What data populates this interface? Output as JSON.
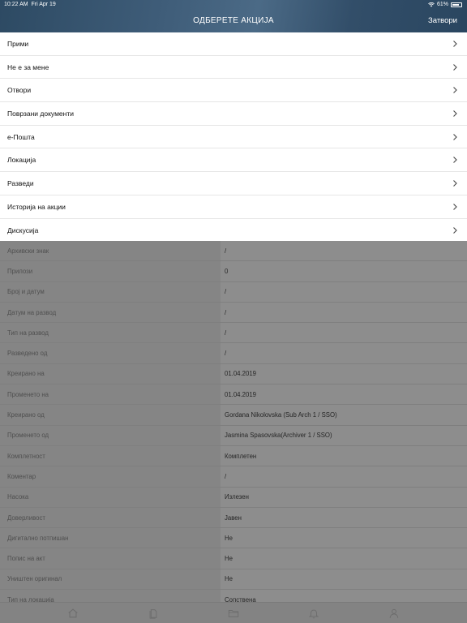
{
  "status_bar": {
    "time": "10:22 AM",
    "date": "Fri Apr 19",
    "battery": "61%"
  },
  "header": {
    "title": "ОДБЕРЕТЕ АКЦИЈА",
    "close_label": "Затвори"
  },
  "actions": [
    {
      "label": "Прими"
    },
    {
      "label": "Не е за мене"
    },
    {
      "label": "Отвори"
    },
    {
      "label": "Поврзани документи"
    },
    {
      "label": "е-Пошта"
    },
    {
      "label": "Локација"
    },
    {
      "label": "Разведи"
    },
    {
      "label": "Историја на акции"
    },
    {
      "label": "Дискусија"
    }
  ],
  "details": [
    {
      "label": "Архивски знак",
      "value": "/"
    },
    {
      "label": "Прилози",
      "value": "0"
    },
    {
      "label": "Број и датум",
      "value": "/"
    },
    {
      "label": "Датум на развод",
      "value": "/"
    },
    {
      "label": "Тип на развод",
      "value": "/"
    },
    {
      "label": "Разведено од",
      "value": "/"
    },
    {
      "label": "Креирано на",
      "value": "01.04.2019"
    },
    {
      "label": "Променето на",
      "value": "01.04.2019"
    },
    {
      "label": "Креирано од",
      "value": "Gordana Nikolovska (Sub Arch 1 / SSO)"
    },
    {
      "label": "Променето од",
      "value": "Jasmina Spasovska(Archiver 1 / SSO)"
    },
    {
      "label": "Комплетност",
      "value": "Комплетен"
    },
    {
      "label": "Коментар",
      "value": "/"
    },
    {
      "label": "Насока",
      "value": "Излезен"
    },
    {
      "label": "Доверливост",
      "value": "Јавен"
    },
    {
      "label": "Дигитално потпишан",
      "value": "Не"
    },
    {
      "label": "Попис на акт",
      "value": "Не"
    },
    {
      "label": "Уништен оригинал",
      "value": "Не"
    },
    {
      "label": "Тип на локација",
      "value": "Сопствена"
    }
  ],
  "tabbar": {
    "icons": [
      "home-icon",
      "documents-icon",
      "folder-icon",
      "bell-icon",
      "user-icon"
    ],
    "tint": "#6d6d6d"
  },
  "colors": {
    "header": "#3f5d79",
    "dim_overlay": "#8a8a8a"
  }
}
